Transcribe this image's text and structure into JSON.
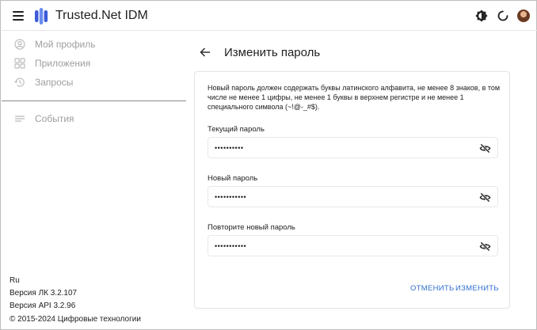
{
  "header": {
    "app_title": "Trusted.Net IDM"
  },
  "sidebar": {
    "items": [
      {
        "label": "Мой профиль",
        "icon": "account-circle-icon"
      },
      {
        "label": "Приложения",
        "icon": "apps-grid-icon"
      },
      {
        "label": "Запросы",
        "icon": "history-icon"
      },
      {
        "label": "События",
        "icon": "list-icon"
      }
    ],
    "footer": {
      "language": "Ru",
      "lk_version": "Версия ЛК 3.2.107",
      "api_version": "Версия API 3.2.96",
      "copyright": "© 2015-2024 Цифровые технологии"
    }
  },
  "main": {
    "title": "Изменить пароль",
    "hint": "Новый пароль должен содержать буквы латинского алфавита, не менее 8 знаков, в том числе не менее 1 цифры, не менее 1 буквы в верхнем регистре и не менее 1 специального символа (~!@-_#$).",
    "fields": [
      {
        "label": "Текущий пароль",
        "value": "••••••••••"
      },
      {
        "label": "Новый пароль",
        "value": "•••••••••••"
      },
      {
        "label": "Повторите новый пароль",
        "value": "•••••••••••"
      }
    ],
    "cancel_label": "ОТМЕНИТЬ",
    "submit_label": "ИЗМЕНИТЬ"
  },
  "colors": {
    "accent": "#2f6fd0",
    "brand": "#3d5bd9",
    "muted_text": "#9e9e9e"
  }
}
